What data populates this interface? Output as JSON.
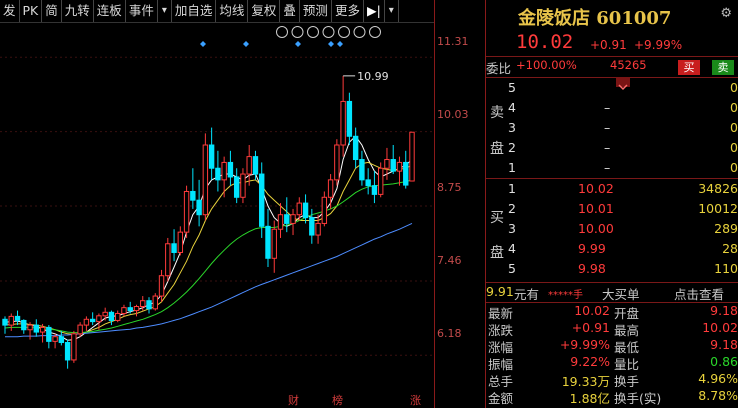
{
  "toolbar": {
    "items": [
      "发",
      "PK",
      "简",
      "九转",
      "连板",
      "事件",
      "▾",
      "加自选",
      "均线",
      "复权",
      "叠",
      "预测",
      "更多"
    ],
    "play": "▶|",
    "menu": "▾"
  },
  "chart": {
    "y_labels": [
      "11.31",
      "10.03",
      "8.75",
      "7.46",
      "6.18"
    ],
    "high_label": "10.99",
    "markers": [
      "财",
      "榜",
      "涨"
    ],
    "top_icons": [
      "eye-icon",
      "eye-icon",
      "pause-icon",
      "play-icon",
      "clock-icon",
      "plus-icon",
      "close-icon"
    ]
  },
  "quote": {
    "name": "金陵饭店",
    "code": "601007",
    "price": "10.02",
    "change": "+0.91",
    "change_pct": "+9.99%",
    "weibi_label": "委比",
    "weibi_value": "+100.00%",
    "weicha_value": "45265",
    "buy_btn": "买",
    "sell_btn": "卖",
    "sell_label": [
      "卖",
      "盘"
    ],
    "sell_rows": [
      {
        "level": "5",
        "price": "",
        "vol": "0"
      },
      {
        "level": "4",
        "price": "–",
        "vol": "0"
      },
      {
        "level": "3",
        "price": "–",
        "vol": "0"
      },
      {
        "level": "2",
        "price": "–",
        "vol": "0"
      },
      {
        "level": "1",
        "price": "–",
        "vol": "0"
      }
    ],
    "buy_label": [
      "买",
      "盘"
    ],
    "buy_rows": [
      {
        "level": "1",
        "price": "10.02",
        "vol": "34826"
      },
      {
        "level": "2",
        "price": "10.01",
        "vol": "10012"
      },
      {
        "level": "3",
        "price": "10.00",
        "vol": "289"
      },
      {
        "level": "4",
        "price": "9.99",
        "vol": "28"
      },
      {
        "level": "5",
        "price": "9.98",
        "vol": "110"
      }
    ],
    "ticker": {
      "a": "9.91",
      "b": "元有",
      "c": "*****手",
      "d": "大买单",
      "e": "点击查看"
    },
    "stats": [
      {
        "l1": "最新",
        "v1": "10.02",
        "l2": "开盘",
        "v2": "9.18"
      },
      {
        "l1": "涨跌",
        "v1": "+0.91",
        "l2": "最高",
        "v2": "10.02"
      },
      {
        "l1": "涨幅",
        "v1": "+9.99%",
        "l2": "最低",
        "v2": "9.18"
      },
      {
        "l1": "振幅",
        "v1": "9.22%",
        "l2": "量比",
        "v2": "0.86"
      },
      {
        "l1": "总手",
        "v1": "19.33万",
        "l2": "换手",
        "v2": "4.96%"
      },
      {
        "l1": "金额",
        "v1": "1.88亿",
        "l2": "换手(实)",
        "v2": "8.78%"
      }
    ]
  },
  "chart_data": {
    "type": "candlestick",
    "y_ticks": [
      11.31,
      10.03,
      8.75,
      7.46,
      6.18
    ],
    "ylim": [
      5.6,
      11.9
    ],
    "candles": [
      [
        6.8,
        6.85,
        6.55,
        6.7
      ],
      [
        6.7,
        6.9,
        6.6,
        6.85
      ],
      [
        6.85,
        6.95,
        6.7,
        6.78
      ],
      [
        6.78,
        6.8,
        6.55,
        6.62
      ],
      [
        6.62,
        6.75,
        6.45,
        6.7
      ],
      [
        6.7,
        6.8,
        6.5,
        6.58
      ],
      [
        6.58,
        6.72,
        6.4,
        6.66
      ],
      [
        6.66,
        6.7,
        6.3,
        6.42
      ],
      [
        6.42,
        6.55,
        6.3,
        6.5
      ],
      [
        6.5,
        6.6,
        6.35,
        6.4
      ],
      [
        6.4,
        6.45,
        5.95,
        6.1
      ],
      [
        6.1,
        6.6,
        6.05,
        6.55
      ],
      [
        6.55,
        6.75,
        6.5,
        6.7
      ],
      [
        6.7,
        6.85,
        6.6,
        6.8
      ],
      [
        6.8,
        6.92,
        6.7,
        6.76
      ],
      [
        6.76,
        6.9,
        6.62,
        6.86
      ],
      [
        6.86,
        7.0,
        6.78,
        6.92
      ],
      [
        6.92,
        6.95,
        6.7,
        6.78
      ],
      [
        6.78,
        6.95,
        6.75,
        6.9
      ],
      [
        6.9,
        7.05,
        6.85,
        7.0
      ],
      [
        7.0,
        7.1,
        6.9,
        6.95
      ],
      [
        6.95,
        7.05,
        6.85,
        7.02
      ],
      [
        7.02,
        7.2,
        6.95,
        7.12
      ],
      [
        7.12,
        7.18,
        6.9,
        6.98
      ],
      [
        6.98,
        7.25,
        6.95,
        7.2
      ],
      [
        7.2,
        7.65,
        7.1,
        7.55
      ],
      [
        7.55,
        8.2,
        7.45,
        8.1
      ],
      [
        8.1,
        8.35,
        7.8,
        7.95
      ],
      [
        7.95,
        8.4,
        7.9,
        8.3
      ],
      [
        8.3,
        9.1,
        8.2,
        9.0
      ],
      [
        9.0,
        9.4,
        8.7,
        8.85
      ],
      [
        8.85,
        9.2,
        8.4,
        8.6
      ],
      [
        8.6,
        10.0,
        8.5,
        9.8
      ],
      [
        9.8,
        10.1,
        9.2,
        9.4
      ],
      [
        9.4,
        9.7,
        9.0,
        9.2
      ],
      [
        9.2,
        9.6,
        8.9,
        9.5
      ],
      [
        9.5,
        9.7,
        9.1,
        9.25
      ],
      [
        9.25,
        9.4,
        8.8,
        8.9
      ],
      [
        8.9,
        9.4,
        8.8,
        9.3
      ],
      [
        9.3,
        9.8,
        9.1,
        9.6
      ],
      [
        9.6,
        9.7,
        9.2,
        9.3
      ],
      [
        9.3,
        9.5,
        8.2,
        8.4
      ],
      [
        8.4,
        8.7,
        7.7,
        7.85
      ],
      [
        7.85,
        8.5,
        7.6,
        8.35
      ],
      [
        8.35,
        8.8,
        8.2,
        8.6
      ],
      [
        8.6,
        8.9,
        8.3,
        8.45
      ],
      [
        8.45,
        8.7,
        8.25,
        8.6
      ],
      [
        8.6,
        8.9,
        8.5,
        8.8
      ],
      [
        8.8,
        8.95,
        8.45,
        8.55
      ],
      [
        8.55,
        8.7,
        8.1,
        8.25
      ],
      [
        8.25,
        8.6,
        8.1,
        8.45
      ],
      [
        8.45,
        9.0,
        8.4,
        8.9
      ],
      [
        8.9,
        9.3,
        8.7,
        9.2
      ],
      [
        9.2,
        9.9,
        9.1,
        9.8
      ],
      [
        9.8,
        10.99,
        9.6,
        10.55
      ],
      [
        10.55,
        10.7,
        9.8,
        9.95
      ],
      [
        9.95,
        10.1,
        9.4,
        9.55
      ],
      [
        9.55,
        9.7,
        9.1,
        9.2
      ],
      [
        9.2,
        9.4,
        8.95,
        9.1
      ],
      [
        9.1,
        9.35,
        8.8,
        8.95
      ],
      [
        8.95,
        9.5,
        8.9,
        9.4
      ],
      [
        9.4,
        9.75,
        9.2,
        9.55
      ],
      [
        9.55,
        9.8,
        9.3,
        9.35
      ],
      [
        9.35,
        9.6,
        9.1,
        9.5
      ],
      [
        9.5,
        9.7,
        9.05,
        9.11
      ],
      [
        9.18,
        10.02,
        9.18,
        10.02
      ]
    ],
    "ma_series": [
      {
        "color": "#ffffff",
        "values": [
          6.75,
          6.76,
          6.77,
          6.74,
          6.7,
          6.68,
          6.64,
          6.58,
          6.55,
          6.5,
          6.44,
          6.45,
          6.5,
          6.58,
          6.66,
          6.74,
          6.82,
          6.85,
          6.86,
          6.9,
          6.93,
          6.96,
          7.0,
          7.05,
          7.1,
          7.22,
          7.45,
          7.7,
          7.95,
          8.3,
          8.6,
          8.75,
          9.05,
          9.2,
          9.25,
          9.3,
          9.3,
          9.25,
          9.2,
          9.28,
          9.3,
          9.05,
          8.75,
          8.55,
          8.45,
          8.4,
          8.45,
          8.55,
          8.6,
          8.55,
          8.55,
          8.65,
          8.8,
          9.05,
          9.55,
          9.85,
          9.95,
          9.8,
          9.55,
          9.35,
          9.25,
          9.3,
          9.35,
          9.4,
          9.45,
          9.55
        ]
      },
      {
        "color": "#e8d23c",
        "values": [
          6.7,
          6.71,
          6.72,
          6.72,
          6.71,
          6.7,
          6.68,
          6.65,
          6.62,
          6.58,
          6.55,
          6.54,
          6.55,
          6.58,
          6.62,
          6.66,
          6.72,
          6.76,
          6.8,
          6.85,
          6.88,
          6.9,
          6.94,
          6.98,
          7.02,
          7.1,
          7.25,
          7.4,
          7.6,
          7.8,
          8.05,
          8.25,
          8.5,
          8.7,
          8.85,
          9.0,
          9.1,
          9.15,
          9.15,
          9.18,
          9.2,
          9.1,
          8.95,
          8.85,
          8.75,
          8.65,
          8.55,
          8.5,
          8.5,
          8.5,
          8.5,
          8.55,
          8.62,
          8.75,
          9.0,
          9.2,
          9.4,
          9.48,
          9.5,
          9.45,
          9.4,
          9.38,
          9.36,
          9.38,
          9.4,
          9.45
        ]
      },
      {
        "color": "#2ad62a",
        "values": [
          6.65,
          6.66,
          6.66,
          6.66,
          6.66,
          6.65,
          6.64,
          6.63,
          6.62,
          6.6,
          6.58,
          6.57,
          6.57,
          6.58,
          6.59,
          6.61,
          6.63,
          6.65,
          6.68,
          6.71,
          6.74,
          6.77,
          6.8,
          6.84,
          6.88,
          6.93,
          7.0,
          7.08,
          7.17,
          7.27,
          7.38,
          7.5,
          7.63,
          7.76,
          7.88,
          7.99,
          8.09,
          8.18,
          8.25,
          8.31,
          8.36,
          8.38,
          8.38,
          8.38,
          8.4,
          8.42,
          8.45,
          8.5,
          8.55,
          8.6,
          8.63,
          8.66,
          8.7,
          8.75,
          8.82,
          8.9,
          8.98,
          9.04,
          9.08,
          9.1,
          9.11,
          9.12,
          9.13,
          9.15,
          9.17,
          9.2
        ]
      },
      {
        "color": "#4d8cff",
        "values": [
          6.5,
          6.5,
          6.5,
          6.51,
          6.51,
          6.51,
          6.52,
          6.52,
          6.52,
          6.53,
          6.53,
          6.54,
          6.55,
          6.56,
          6.57,
          6.58,
          6.59,
          6.6,
          6.61,
          6.62,
          6.63,
          6.65,
          6.66,
          6.68,
          6.7,
          6.72,
          6.75,
          6.78,
          6.81,
          6.85,
          6.89,
          6.93,
          6.97,
          7.01,
          7.06,
          7.11,
          7.16,
          7.21,
          7.26,
          7.31,
          7.36,
          7.4,
          7.44,
          7.48,
          7.52,
          7.56,
          7.6,
          7.64,
          7.68,
          7.72,
          7.76,
          7.8,
          7.84,
          7.88,
          7.93,
          7.98,
          8.03,
          8.08,
          8.13,
          8.18,
          8.22,
          8.27,
          8.31,
          8.35,
          8.4,
          8.45
        ]
      }
    ],
    "colors": {
      "up": "#ff3b3b",
      "down": "#00e5ff",
      "axis": "#c24b4b",
      "title": "#e8c44a"
    }
  }
}
